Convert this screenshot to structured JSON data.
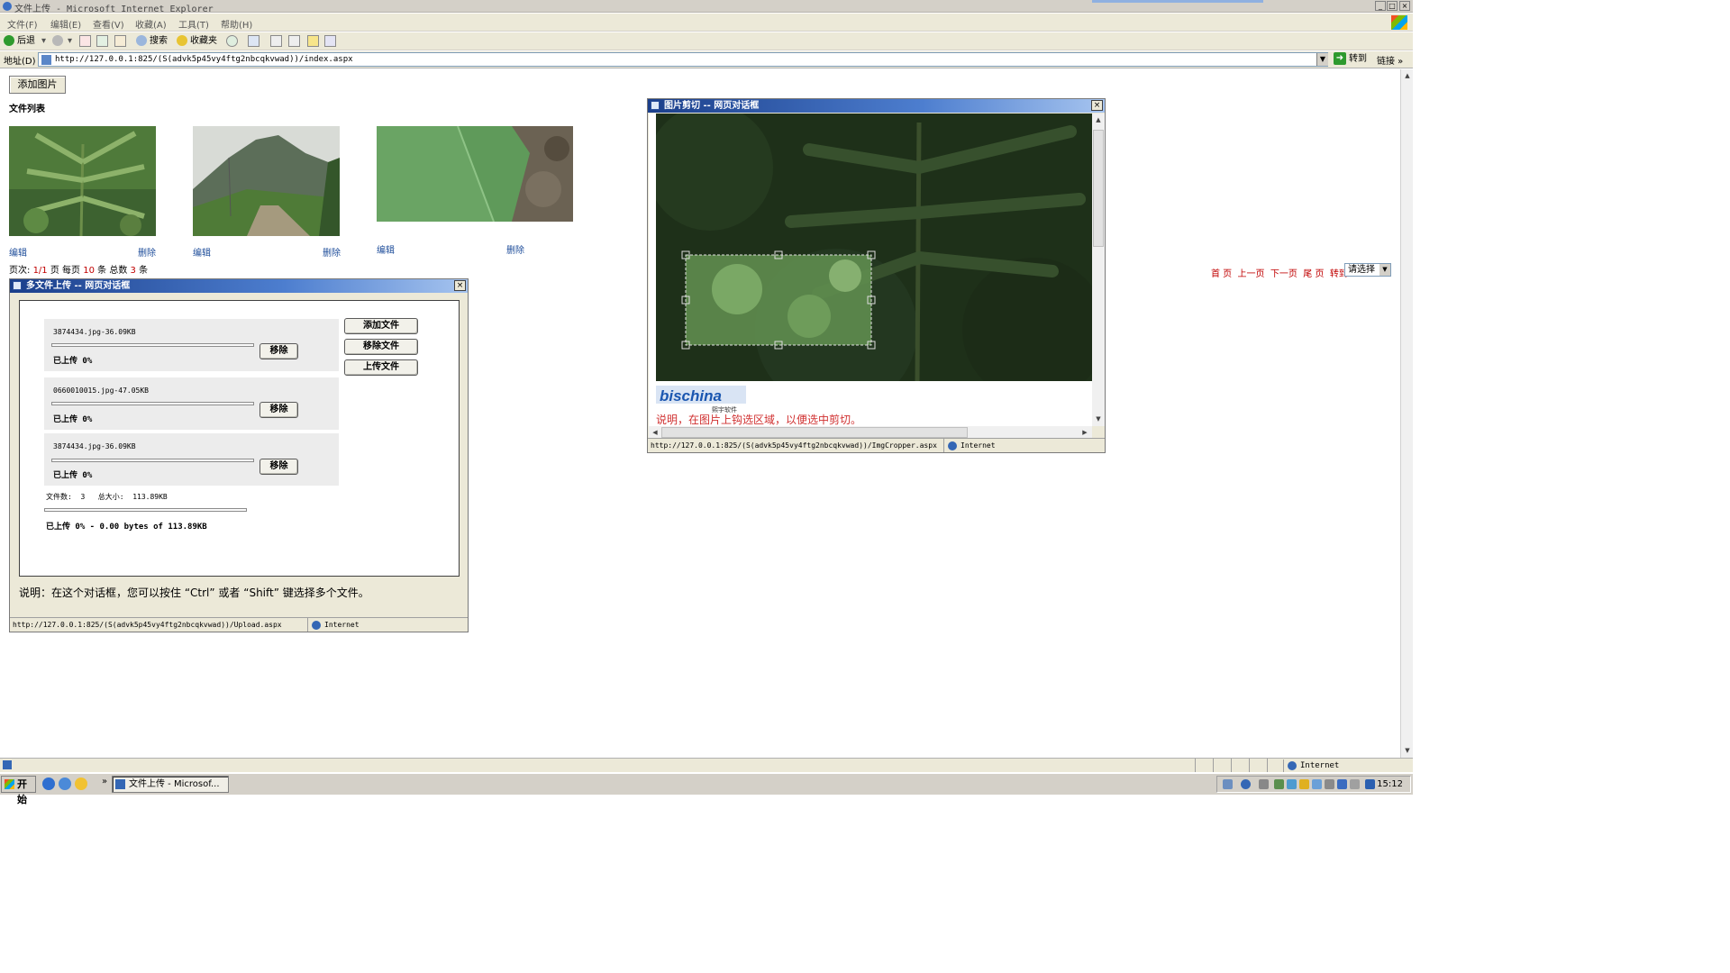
{
  "window": {
    "title": "文件上传 - Microsoft Internet Explorer",
    "controls": [
      "_",
      "□",
      "×"
    ]
  },
  "menu": [
    "文件(F)",
    "编辑(E)",
    "查看(V)",
    "收藏(A)",
    "工具(T)",
    "帮助(H)"
  ],
  "toolbar": {
    "back_label": "后退",
    "search_label": "搜索",
    "favorites_label": "收藏夹"
  },
  "address": {
    "label": "地址(D)",
    "url": "http://127.0.0.1:825/(S(advk5p45vy4ftg2nbcqkvwad))/index.aspx",
    "go_label": "转到",
    "links_label": "链接"
  },
  "page": {
    "add_image_button": "添加图片",
    "file_list_title": "文件列表",
    "thumbnails": [
      {
        "edit": "编辑",
        "delete": "删除"
      },
      {
        "edit": "编辑",
        "delete": "删除"
      },
      {
        "edit": "编辑",
        "delete": "删除"
      }
    ],
    "pager": {
      "page_label": "页次:",
      "page_value": "1/1",
      "page_unit": "页",
      "per_page_label": "每页",
      "per_page_value": "10",
      "per_page_unit": "条",
      "total_label": "总数",
      "total_value": "3",
      "total_unit": "条",
      "first": "首 页",
      "prev": "上一页",
      "next": "下一页",
      "last": "尾 页",
      "goto": "转到",
      "select_value": "请选择"
    }
  },
  "upload_dialog": {
    "title": "多文件上传 -- 网页对话框",
    "files": [
      {
        "name": "3874434.jpg-36.09KB",
        "status": "已上传 0%",
        "progress": 0,
        "remove": "移除"
      },
      {
        "name": "0660010015.jpg-47.05KB",
        "status": "已上传 0%",
        "progress": 0,
        "remove": "移除"
      },
      {
        "name": "3874434.jpg-36.09KB",
        "status": "已上传 0%",
        "progress": 0,
        "remove": "移除"
      }
    ],
    "buttons": {
      "add": "添加文件",
      "remove": "移除文件",
      "upload": "上传文件"
    },
    "file_count_label": "文件数:",
    "file_count": "3",
    "total_size_label": "总大小:",
    "total_size": "113.89KB",
    "total_status": "已上传 0% - 0.00 bytes of 113.89KB",
    "total_progress": 0,
    "note": "说明：在这个对话框，您可以按住 “Ctrl” 或者 “Shift” 键选择多个文件。",
    "status_url": "http://127.0.0.1:825/(S(advk5p45vy4ftg2nbcqkvwad))/Upload.aspx",
    "zone": "Internet"
  },
  "cropper_dialog": {
    "title": "图片剪切 -- 网页对话框",
    "logo_text": "bischina",
    "logo_sub": "熙宇软件",
    "note": "说明，在图片上钩选区域，以便选中剪切。",
    "status_url": "http://127.0.0.1:825/(S(advk5p45vy4ftg2nbcqkvwad))/ImgCropper.aspx",
    "zone": "Internet"
  },
  "status_bar": {
    "zone": "Internet"
  },
  "taskbar": {
    "start_label": "开始",
    "task_label": "文件上传 - Microsof...",
    "clock": "15:12"
  },
  "colors": {
    "link": "#1e4d9a",
    "pager_red": "#c00000",
    "dialog_title_start": "#1b3f8b",
    "crop_note": "#d03030"
  }
}
